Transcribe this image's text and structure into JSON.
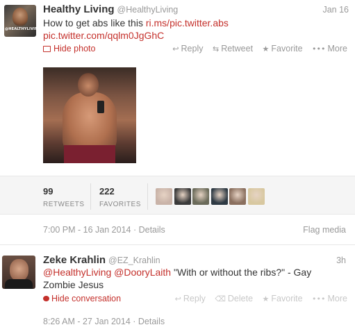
{
  "main_tweet": {
    "fullname": "Healthy Living",
    "username": "@HealthyLiving",
    "time": "Jan 16",
    "avatar_text": "@HEALTHYLIVING",
    "text_prefix": "How to get abs like this",
    "link1": "ri.ms/pic.twitter.abs",
    "link2": "pic.twitter.com/qqlm0JgGhC",
    "hide_photo": "Hide photo",
    "actions": {
      "reply": "Reply",
      "retweet": "Retweet",
      "favorite": "Favorite",
      "more": "More"
    },
    "stats": {
      "retweets_count": "99",
      "retweets_label": "RETWEETS",
      "favorites_count": "222",
      "favorites_label": "FAVORITES"
    },
    "timestamp": "7:00 PM - 16 Jan 2014",
    "details": "Details",
    "flag": "Flag media",
    "favoriter_colors": [
      "#c9b3a8",
      "#3a3a3a",
      "#6b6b5a",
      "#2e3a44",
      "#8a6f5e",
      "#d8c8a0"
    ]
  },
  "reply_tweet": {
    "fullname": "Zeke Krahlin",
    "username": "@EZ_Krahlin",
    "time": "3h",
    "mention1": "@HealthyLiving",
    "mention2": "@DooryLaith",
    "text": "\"With or without the ribs?\" - Gay Zombie Jesus",
    "hide_conversation": "Hide conversation",
    "actions": {
      "reply": "Reply",
      "delete": "Delete",
      "favorite": "Favorite",
      "more": "More"
    },
    "timestamp": "8:26 AM - 27 Jan 2014",
    "details": "Details"
  },
  "icons": {
    "reply_glyph": "↩",
    "retweet_glyph": "⇆",
    "favorite_glyph": "★",
    "more_glyph": "•••",
    "delete_glyph": "🗑"
  },
  "colors": {
    "link": "#c4302b",
    "muted": "#999999"
  }
}
